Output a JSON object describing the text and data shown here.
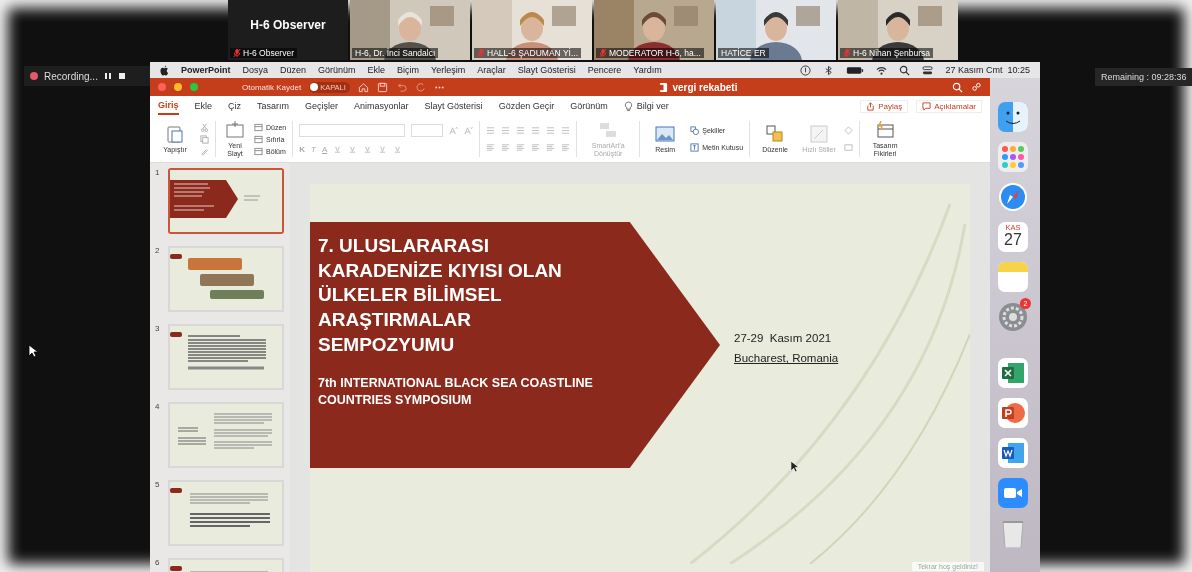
{
  "video_tiles": [
    {
      "kind": "name",
      "title": "H-6 Observer",
      "label": "H-6 Observer",
      "muted": true
    },
    {
      "kind": "video",
      "label": "H-6, Dr. İnci Sandalcı",
      "muted": false
    },
    {
      "kind": "video",
      "label": "HALL-6 ŞADUMAN Yİ...",
      "muted": true
    },
    {
      "kind": "video",
      "label": "MODERATOR H-6, ha...",
      "muted": true
    },
    {
      "kind": "video",
      "label": "HATİCE ER",
      "muted": false
    },
    {
      "kind": "video",
      "label": "H-6 Nihan Şenbursa",
      "muted": true
    }
  ],
  "recording": {
    "label": "Recording..."
  },
  "timer": {
    "label": "Remaining : 09:28:36"
  },
  "menu_bar": {
    "app": "PowerPoint",
    "items": [
      "Dosya",
      "Düzen",
      "Görünüm",
      "Ekle",
      "Biçim",
      "Yerleşim",
      "Araçlar",
      "Slayt Gösterisi",
      "Pencere",
      "Yardım"
    ],
    "clock": "27 Kasım Cmt  10:25"
  },
  "title_bar": {
    "autosave_label": "Otomatik Kaydet",
    "autosave_on": false,
    "autosave_state": "KAPALI",
    "document": "vergi rekabeti"
  },
  "ribbon_tabs": [
    {
      "label": "Giriş",
      "selected": true
    },
    {
      "label": "Ekle",
      "selected": false
    },
    {
      "label": "Çiz",
      "selected": false
    },
    {
      "label": "Tasarım",
      "selected": false
    },
    {
      "label": "Geçişler",
      "selected": false
    },
    {
      "label": "Animasyonlar",
      "selected": false
    },
    {
      "label": "Slayt Gösterisi",
      "selected": false
    },
    {
      "label": "Gözden Geçir",
      "selected": false
    },
    {
      "label": "Görünüm",
      "selected": false
    }
  ],
  "tell_me": "Bilgi ver",
  "share_button": "Paylaş",
  "comments_button": "Açıklamalar",
  "ribbon": {
    "paste": {
      "label": "Yapıştır"
    },
    "new_slide": {
      "label": "Yeni Slayt"
    },
    "layout": {
      "label": "Düzen"
    },
    "reset": {
      "label": "Sıfırla"
    },
    "section": {
      "label": "Bölüm"
    },
    "font_buttons": [
      "K",
      "T",
      "A"
    ],
    "smartart": {
      "label": "SmartArt'a Dönüştür",
      "disabled": true
    },
    "picture": {
      "label": "Resim"
    },
    "shapes": {
      "label": "Şekiller"
    },
    "text_box": {
      "label": "Metin Kutusu"
    },
    "arrange": {
      "label": "Düzenle"
    },
    "quick_styles": {
      "label": "Hızlı Stiller",
      "disabled": true
    },
    "design_ideas": {
      "label": "Tasarım Fikirleri"
    }
  },
  "thumbnails": [
    {
      "number": "1",
      "selected": true,
      "kind": "title"
    },
    {
      "number": "2",
      "selected": false,
      "kind": "process"
    },
    {
      "number": "3",
      "selected": false,
      "kind": "text"
    },
    {
      "number": "4",
      "selected": false,
      "kind": "columns"
    },
    {
      "number": "5",
      "selected": false,
      "kind": "bullets"
    },
    {
      "number": "6",
      "selected": false,
      "kind": "bullets"
    }
  ],
  "slide": {
    "title_lines": [
      "7. ULUSLARARASI",
      "KARADENİZE KIYISI OLAN",
      "ÜLKELER BİLİMSEL",
      "ARAŞTIRMALAR",
      "SEMPOZYUMU"
    ],
    "subtitle_lines": [
      "7th INTERNATIONAL BLACK SEA COASTLINE",
      "COUNTRIES SYMPOSIUM"
    ],
    "date": "27-29  Kasım 2021",
    "place": "Bucharest, Romania"
  },
  "notice": "Tekrar hoş geldiniz!",
  "dock": [
    {
      "kind": "finder"
    },
    {
      "kind": "launchpad"
    },
    {
      "kind": "safari"
    },
    {
      "kind": "calendar",
      "month": "KAS",
      "day": "27"
    },
    {
      "kind": "notes"
    },
    {
      "kind": "settings",
      "badge": "2"
    },
    {
      "kind": "excel"
    },
    {
      "kind": "powerpoint"
    },
    {
      "kind": "word"
    },
    {
      "kind": "zoom"
    },
    {
      "kind": "trash"
    }
  ]
}
